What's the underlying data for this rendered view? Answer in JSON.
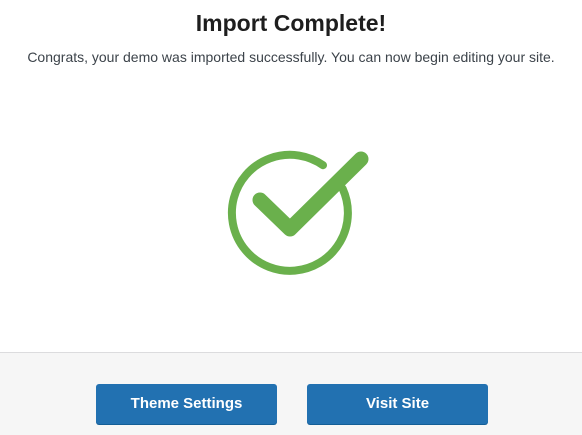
{
  "dialog": {
    "title": "Import Complete!",
    "message": "Congrats, your demo was imported successfully. You can now begin editing your site.",
    "status_icon": "check-circle-icon",
    "success_color": "#6ab04c"
  },
  "footer": {
    "theme_settings_label": "Theme Settings",
    "visit_site_label": "Visit Site",
    "button_color": "#2271b1"
  }
}
